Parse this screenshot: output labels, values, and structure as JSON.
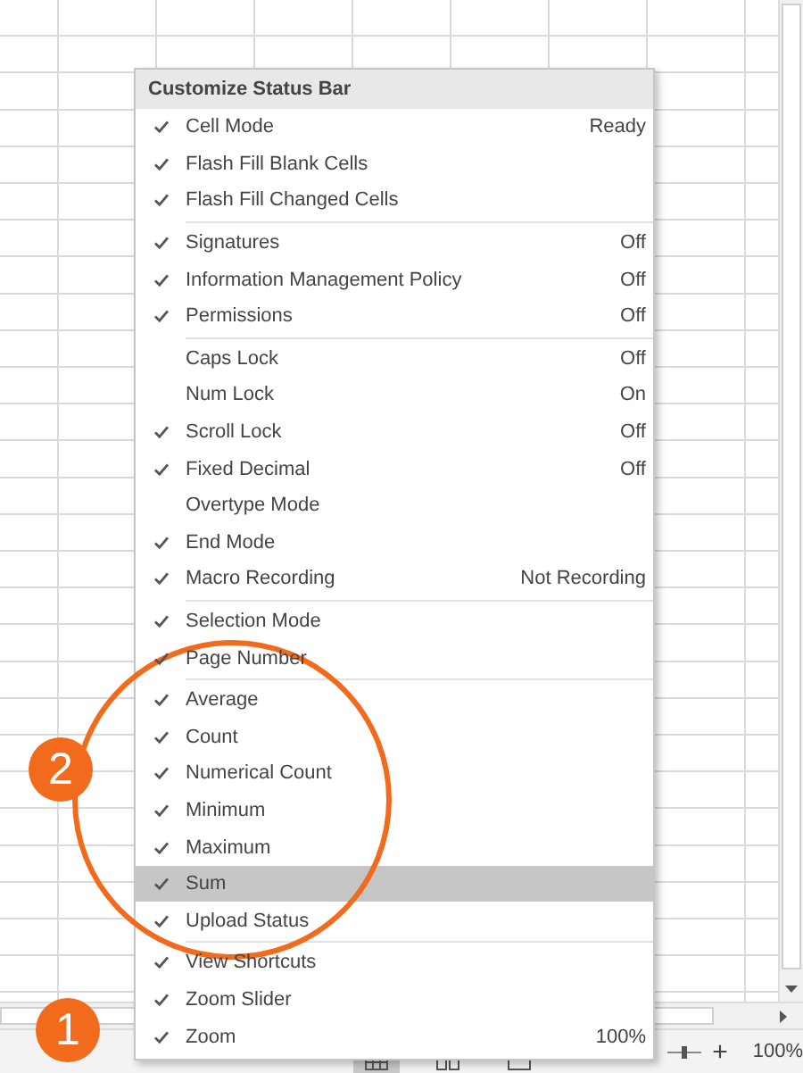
{
  "menu": {
    "title": "Customize Status Bar",
    "sections": [
      {
        "items": [
          {
            "label": "Cell Mode",
            "value": "Ready",
            "checked": true,
            "selected": false
          },
          {
            "label": "Flash Fill Blank Cells",
            "checked": true,
            "selected": false
          },
          {
            "label": "Flash Fill Changed Cells",
            "checked": true,
            "selected": false
          }
        ]
      },
      {
        "items": [
          {
            "label": "Signatures",
            "value": "Off",
            "checked": true,
            "selected": false
          },
          {
            "label": "Information Management Policy",
            "value": "Off",
            "checked": true,
            "selected": false
          },
          {
            "label": "Permissions",
            "value": "Off",
            "checked": true,
            "selected": false
          }
        ]
      },
      {
        "items": [
          {
            "label": "Caps Lock",
            "value": "Off",
            "checked": false,
            "selected": false
          },
          {
            "label": "Num Lock",
            "value": "On",
            "checked": false,
            "selected": false
          },
          {
            "label": "Scroll Lock",
            "value": "Off",
            "checked": true,
            "selected": false
          },
          {
            "label": "Fixed Decimal",
            "value": "Off",
            "checked": true,
            "selected": false
          },
          {
            "label": "Overtype Mode",
            "checked": false,
            "selected": false
          },
          {
            "label": "End Mode",
            "checked": true,
            "selected": false
          },
          {
            "label": "Macro Recording",
            "value": "Not Recording",
            "checked": true,
            "selected": false
          }
        ]
      },
      {
        "items": [
          {
            "label": "Selection Mode",
            "checked": true,
            "selected": false
          },
          {
            "label": "Page Number",
            "checked": true,
            "selected": false
          }
        ]
      },
      {
        "items": [
          {
            "label": "Average",
            "checked": true,
            "selected": false
          },
          {
            "label": "Count",
            "checked": true,
            "selected": false
          },
          {
            "label": "Numerical Count",
            "checked": true,
            "selected": false
          },
          {
            "label": "Minimum",
            "checked": true,
            "selected": false
          },
          {
            "label": "Maximum",
            "checked": true,
            "selected": false
          },
          {
            "label": "Sum",
            "checked": true,
            "selected": true
          },
          {
            "label": "Upload Status",
            "checked": true,
            "selected": false
          }
        ]
      },
      {
        "items": [
          {
            "label": "View Shortcuts",
            "checked": true,
            "selected": false
          },
          {
            "label": "Zoom Slider",
            "checked": true,
            "selected": false
          },
          {
            "label": "Zoom",
            "value": "100%",
            "checked": true,
            "selected": false
          }
        ]
      }
    ]
  },
  "status_bar": {
    "views": [
      {
        "selected": true
      },
      {
        "selected": false
      },
      {
        "selected": false
      }
    ],
    "zoom_slider": {
      "level": 0.5
    },
    "zoom_in": "+",
    "zoom": "100%"
  },
  "annotations": [
    {
      "number": "2"
    },
    {
      "number": "1"
    }
  ]
}
